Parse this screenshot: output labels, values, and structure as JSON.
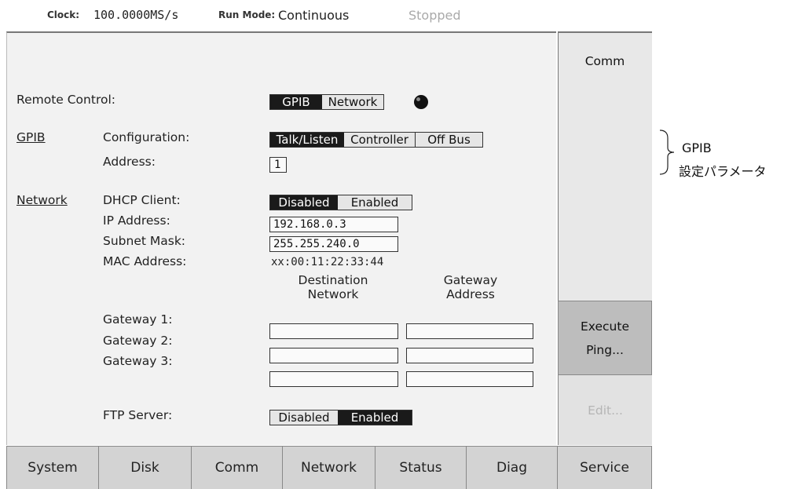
{
  "status_bar": {
    "clock_label": "Clock:",
    "clock_value": "100.0000MS/s",
    "run_mode_label": "Run Mode:",
    "run_mode_value": "Continuous",
    "run_state": "Stopped"
  },
  "remote_control": {
    "label": "Remote Control:",
    "options": [
      "GPIB",
      "Network"
    ],
    "selected": "GPIB"
  },
  "gpib": {
    "section_label": "GPIB",
    "configuration_label": "Configuration:",
    "configuration_options": [
      "Talk/Listen",
      "Controller",
      "Off Bus"
    ],
    "configuration_selected": "Talk/Listen",
    "address_label": "Address:",
    "address_value": "1"
  },
  "network": {
    "section_label": "Network",
    "dhcp_label": "DHCP Client:",
    "dhcp_options": [
      "Disabled",
      "Enabled"
    ],
    "dhcp_selected": "Disabled",
    "ip_label": "IP Address:",
    "ip_value": "192.168.0.3",
    "subnet_label": "Subnet Mask:",
    "subnet_value": "255.255.240.0",
    "mac_label": "MAC Address:",
    "mac_value": "xx:00:11:22:33:44",
    "dest_col_line1": "Destination",
    "dest_col_line2": "Network",
    "gw_col_line1": "Gateway",
    "gw_col_line2": "Address",
    "gateways": [
      {
        "label": "Gateway 1:",
        "destination": "",
        "address": ""
      },
      {
        "label": "Gateway 2:",
        "destination": "",
        "address": ""
      },
      {
        "label": "Gateway 3:",
        "destination": "",
        "address": ""
      }
    ],
    "ftp_label": "FTP Server:",
    "ftp_options": [
      "Disabled",
      "Enabled"
    ],
    "ftp_selected": "Enabled"
  },
  "side_menu": {
    "title": "Comm",
    "execute_line1": "Execute",
    "execute_line2": "Ping...",
    "edit": "Edit..."
  },
  "tabs": [
    "System",
    "Disk",
    "Comm",
    "Network",
    "Status",
    "Diag",
    "Service"
  ],
  "annotation": {
    "line1": "GPIB",
    "line2": "設定パラメータ"
  }
}
